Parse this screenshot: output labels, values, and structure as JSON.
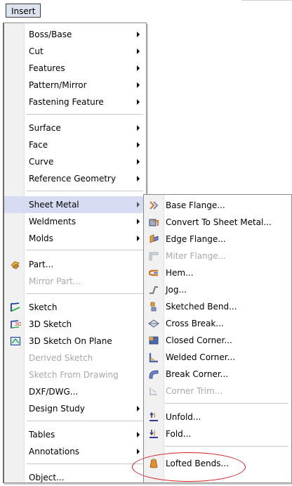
{
  "menubar": {
    "insert_label": "Insert"
  },
  "main_menu": {
    "items": [
      {
        "label": "Boss/Base",
        "sub": true
      },
      {
        "label": "Cut",
        "sub": true
      },
      {
        "label": "Features",
        "sub": true
      },
      {
        "label": "Pattern/Mirror",
        "sub": true
      },
      {
        "label": "Fastening Feature",
        "sub": true
      },
      {
        "label": "Surface",
        "sub": true
      },
      {
        "label": "Face",
        "sub": true
      },
      {
        "label": "Curve",
        "sub": true
      },
      {
        "label": "Reference Geometry",
        "sub": true
      },
      {
        "label": "Sheet Metal",
        "sub": true
      },
      {
        "label": "Weldments",
        "sub": true
      },
      {
        "label": "Molds",
        "sub": true
      },
      {
        "label": "Part...",
        "icon": "part-icon"
      },
      {
        "label": "Mirror Part...",
        "disabled": true
      },
      {
        "label": "Sketch",
        "icon": "sketch-icon"
      },
      {
        "label": "3D Sketch",
        "icon": "3d-sketch-icon"
      },
      {
        "label": "3D Sketch On Plane",
        "icon": "3d-sketch-on-plane-icon"
      },
      {
        "label": "Derived Sketch",
        "disabled": true
      },
      {
        "label": "Sketch From Drawing",
        "disabled": true
      },
      {
        "label": "DXF/DWG..."
      },
      {
        "label": "Design Study",
        "sub": true
      },
      {
        "label": "Tables",
        "sub": true
      },
      {
        "label": "Annotations",
        "sub": true
      },
      {
        "label": "Object..."
      }
    ]
  },
  "sheet_metal_menu": {
    "items": [
      {
        "label": "Base Flange...",
        "icon": "base-flange-icon"
      },
      {
        "label": "Convert To Sheet Metal...",
        "icon": "convert-to-sheet-metal-icon"
      },
      {
        "label": "Edge Flange...",
        "icon": "edge-flange-icon"
      },
      {
        "label": "Miter Flange...",
        "icon": "miter-flange-icon",
        "disabled": true
      },
      {
        "label": "Hem...",
        "icon": "hem-icon"
      },
      {
        "label": "Jog...",
        "icon": "jog-icon"
      },
      {
        "label": "Sketched Bend...",
        "icon": "sketched-bend-icon"
      },
      {
        "label": "Cross Break...",
        "icon": "cross-break-icon"
      },
      {
        "label": "Closed Corner...",
        "icon": "closed-corner-icon"
      },
      {
        "label": "Welded Corner...",
        "icon": "welded-corner-icon"
      },
      {
        "label": "Break Corner...",
        "icon": "break-corner-icon"
      },
      {
        "label": "Corner Trim...",
        "icon": "corner-trim-icon",
        "disabled": true
      },
      {
        "label": "Unfold...",
        "icon": "unfold-icon"
      },
      {
        "label": "Fold...",
        "icon": "fold-icon"
      },
      {
        "label": "Lofted Bends...",
        "icon": "lofted-bends-icon"
      }
    ]
  },
  "colors": {
    "highlight": "#d8dcf3",
    "annotation_ellipse": "#d21c1c",
    "disabled_text": "#a8a8a8"
  }
}
